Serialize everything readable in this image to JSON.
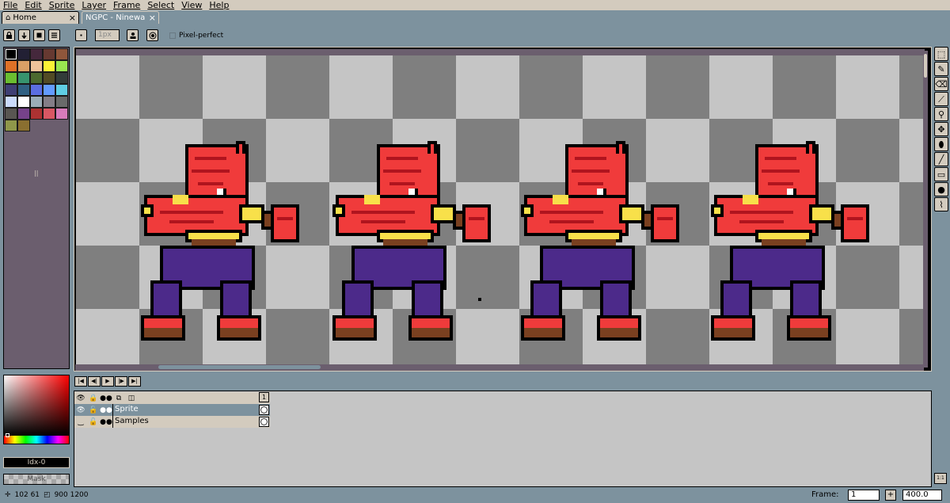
{
  "menu": [
    "File",
    "Edit",
    "Sprite",
    "Layer",
    "Frame",
    "Select",
    "View",
    "Help"
  ],
  "tabs": {
    "home_label": "Home",
    "active_label": "NGPC - Ninewa",
    "close_glyph": "×"
  },
  "context": {
    "brush_size": "1px",
    "pixel_perfect_label": "Pixel-perfect",
    "pixel_perfect_checked": false
  },
  "palette": {
    "colors": [
      "#000000",
      "#222034",
      "#45283c",
      "#663931",
      "#8f563b",
      "#df7126",
      "#d9a066",
      "#eec39a",
      "#fbf236",
      "#99e550",
      "#6abe30",
      "#37946e",
      "#4b692f",
      "#524b24",
      "#323c39",
      "#3f3f74",
      "#306082",
      "#5b6ee1",
      "#639bff",
      "#5fcde4",
      "#cbdbfc",
      "#ffffff",
      "#9badb7",
      "#847e87",
      "#696a6a",
      "#595652",
      "#76428a",
      "#ac3232",
      "#d95763",
      "#d77bba",
      "#8f974a",
      "#8a6f30"
    ],
    "marker": "||"
  },
  "colors": {
    "accent": "#7d929e",
    "panel": "#d3cbbe",
    "palette_bg": "#6b5e6e",
    "sprite_red": "#f03b3b",
    "sprite_dark_red": "#b0141e",
    "sprite_yellow": "#f8e04a",
    "sprite_brown": "#7a4020",
    "sprite_purple": "#4c2a8a"
  },
  "color_picker": {
    "index_label": "Idx-0",
    "mask_label": "Mask"
  },
  "animation_controls": [
    "first-frame-icon",
    "prev-frame-icon",
    "play-icon",
    "next-frame-icon",
    "last-frame-icon"
  ],
  "timeline": {
    "frame_number": "1",
    "layers": [
      {
        "name": "Sprite",
        "selected": true
      },
      {
        "name": "Samples",
        "selected": false
      }
    ]
  },
  "status": {
    "cursor_pos": "102 61",
    "size_label": "900 1200",
    "frame_label": "Frame:",
    "frame_value": "1",
    "plus_label": "+",
    "zoom_value": "400.0"
  },
  "tools": [
    "marquee-icon",
    "pencil-icon",
    "eraser-icon",
    "eyedropper-icon",
    "zoom-icon",
    "move-icon",
    "paint-bucket-icon",
    "line-icon",
    "rectangle-icon",
    "ellipse-icon",
    "blur-icon"
  ]
}
